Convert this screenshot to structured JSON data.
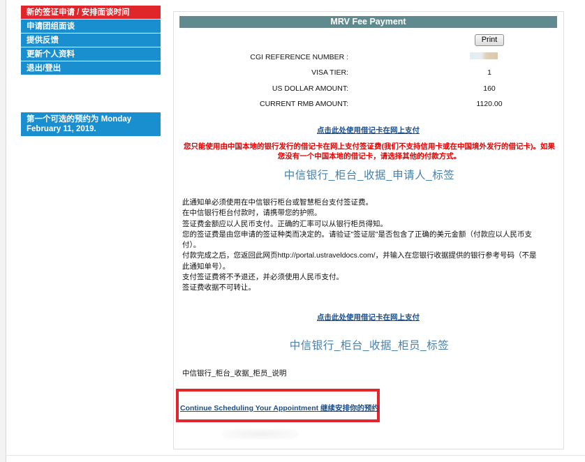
{
  "sidebar": {
    "items": [
      {
        "label": "新的签证申请 / 安排面谈时间",
        "active": true
      },
      {
        "label": "申请团组面谈",
        "active": false
      },
      {
        "label": "提供反馈",
        "active": false
      },
      {
        "label": "更新个人资料",
        "active": false
      },
      {
        "label": "退出/登出",
        "active": false
      }
    ],
    "note": "第一个可选的预约为 Monday February 11, 2019."
  },
  "panel": {
    "title": "MRV Fee Payment",
    "print_label": "Print",
    "fees": [
      {
        "label": "CGI REFERENCE NUMBER :",
        "value": ""
      },
      {
        "label": "VISA TIER:",
        "value": "1"
      },
      {
        "label": "US DOLLAR AMOUNT:",
        "value": "160"
      },
      {
        "label": "CURRENT RMB AMOUNT:",
        "value": "1120.00"
      }
    ],
    "pay_link_1": "点击此处使用借记卡在网上支付",
    "warning_line1": "您只能使用由中国本地的银行发行的借记卡在网上支付签证费(我们不支持信用卡或在中国境外发行的借记卡)。如果",
    "warning_line2": "您没有一个中国本地的借记卡，请选择其他的付款方式。",
    "heading_applicant": "中信银行_柜台_收据_申请人_标签",
    "notice_lines": [
      "此通知单必须使用在中信银行柜台或智慧柜台支付签证费。",
      "在中信银行柜台付款时，请携带您的护照。",
      "签证费金额应以人民币支付。正确的汇率可以从银行柜员得知。",
      "您的签证费是由您申请的签证种类而决定的。请验证\"签证层\"是否包含了正确的美元金额（付款应以人民币支",
      "付）。",
      "付款完成之后，您返回此网页http://portal.ustraveldocs.com/，并输入在您银行收据提供的银行参考号码（不是",
      "此通知单号）。",
      "支付签证费将不予退还，并必须使用人民币支付。",
      "签证费收据不可转让。"
    ],
    "pay_link_2": "点击此处使用借记卡在网上支付",
    "heading_teller": "中信银行_柜台_收据_柜员_标签",
    "caption_teller": "中信银行_柜台_收据_柜员_说明",
    "continue_label": "Continue Scheduling Your Appointment 继续安排你的预约"
  },
  "colors": {
    "sidebar_blue": "#1a8fd0",
    "sidebar_active": "#e0262b",
    "header_teal": "#5f8a8e",
    "highlight_red": "#e2262b",
    "warning_red": "#e60000",
    "link_blue": "#1a4f8b"
  }
}
